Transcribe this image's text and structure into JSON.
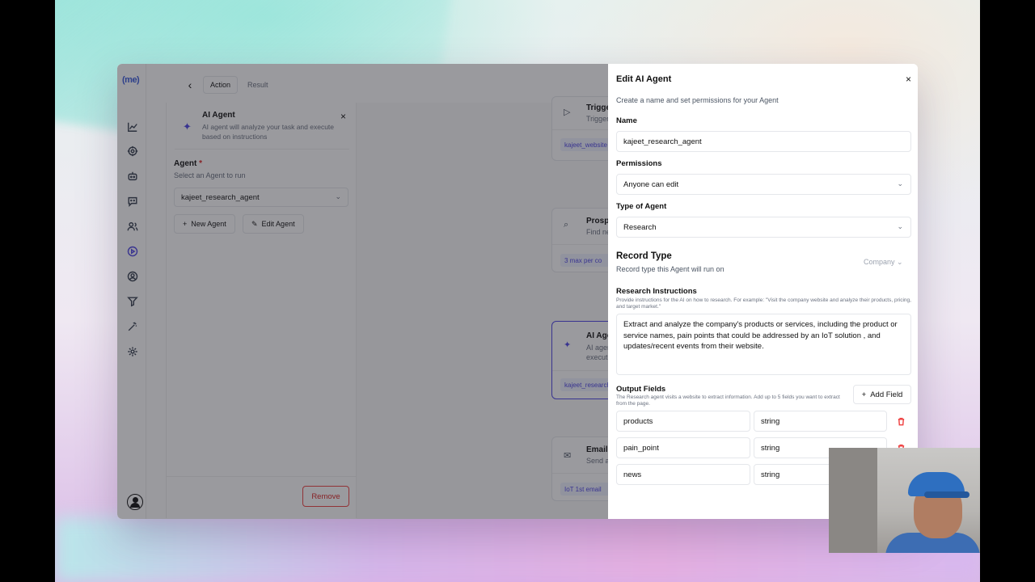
{
  "app": {
    "logo": "(me)"
  },
  "tabs": {
    "action": "Action",
    "result": "Result"
  },
  "panel": {
    "title": "AI Agent",
    "description": "AI agent will analyze your task and execute based on instructions",
    "agent_label": "Agent",
    "required_mark": "*",
    "agent_sub": "Select an Agent to run",
    "agent_value": "kajeet_research_agent",
    "new_agent": "New Agent",
    "edit_agent": "Edit Agent",
    "remove": "Remove"
  },
  "nodes": [
    {
      "title": "Trigger",
      "sub": "Trigger",
      "chip": "kajeet_website"
    },
    {
      "title": "Prospect",
      "sub": "Find new",
      "chip": "3 max per co"
    },
    {
      "title": "AI Agent",
      "sub": "AI agent",
      "sub2": "execute",
      "chip": "kajeet_research"
    },
    {
      "title": "Email",
      "sub": "Send a",
      "chip": "IoT 1st email"
    }
  ],
  "dialog": {
    "title": "Edit AI Agent",
    "subtitle": "Create a name and set permissions for your Agent",
    "name_label": "Name",
    "name_value": "kajeet_research_agent",
    "permissions_label": "Permissions",
    "permissions_value": "Anyone can edit",
    "type_label": "Type of Agent",
    "type_value": "Research",
    "record_type_title": "Record Type",
    "record_type_sub": "Record type this Agent will run on",
    "record_type_value": "Company",
    "instructions_title": "Research Instructions",
    "instructions_help": "Provide instructions for the AI on how to research. For example: \"Visit the company website and analyze their products, pricing, and target market.\"",
    "instructions_value": "Extract and analyze the company's products or services, including the product or service names, pain points that could be addressed by an IoT solution , and updates/recent events from their website.",
    "output_title": "Output Fields",
    "output_help": "The Research agent visits a website to extract information. Add up to 5 fields you want to extract from the page.",
    "add_field": "Add Field",
    "fields": [
      {
        "name": "products",
        "type": "string"
      },
      {
        "name": "pain_point",
        "type": "string"
      },
      {
        "name": "news",
        "type": "string"
      }
    ]
  },
  "colors": {
    "accent": "#4f46e5",
    "danger": "#dc2626"
  }
}
